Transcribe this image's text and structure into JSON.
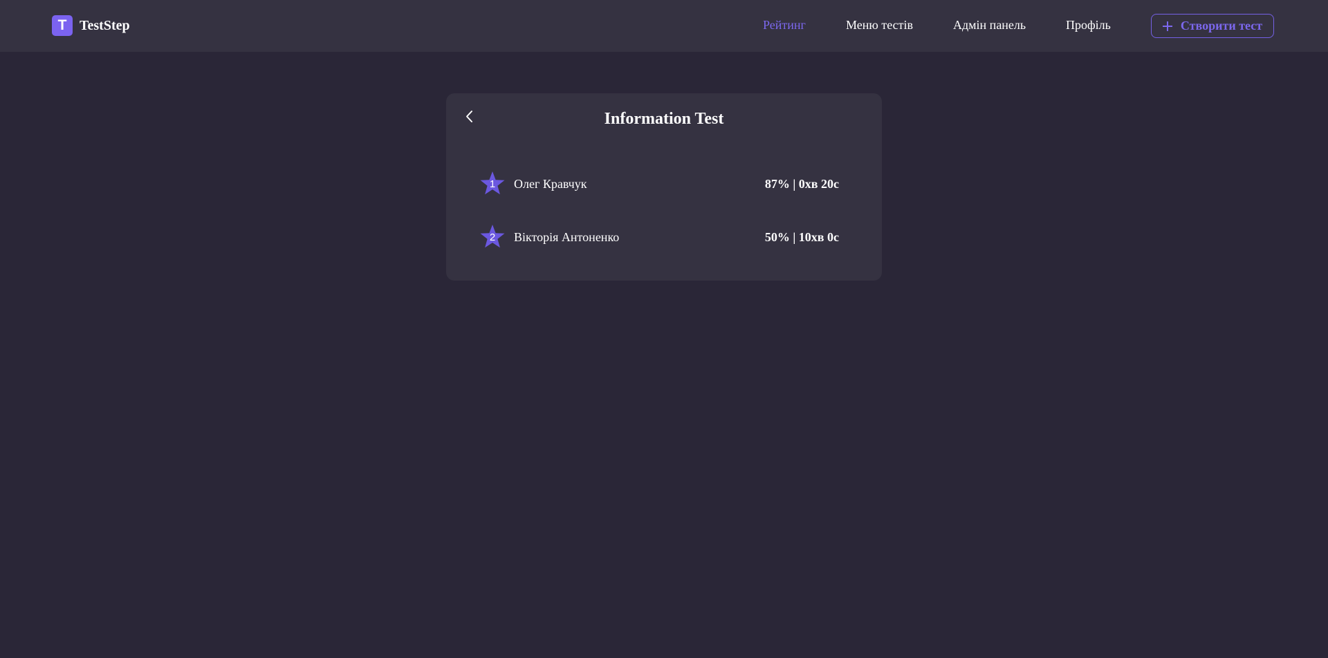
{
  "app": {
    "name": "TestStep",
    "logo_letter": "T",
    "accent_color": "#7b63f0"
  },
  "nav": {
    "items": [
      {
        "label": "Рейтинг",
        "active": true
      },
      {
        "label": "Меню тестів",
        "active": false
      },
      {
        "label": "Адмін панель",
        "active": false
      },
      {
        "label": "Профіль",
        "active": false
      }
    ],
    "create_button": {
      "label": "Створити тест",
      "icon": "plus-icon"
    }
  },
  "leaderboard": {
    "title": "Information Test",
    "back_icon": "chevron-left-icon",
    "rank_icon": "star-icon",
    "entries": [
      {
        "rank": "1",
        "name": "Олег Кравчук",
        "score": "87% | 0хв 20с"
      },
      {
        "rank": "2",
        "name": "Вікторія Антоненко",
        "score": "50% | 10хв 0с"
      }
    ]
  }
}
